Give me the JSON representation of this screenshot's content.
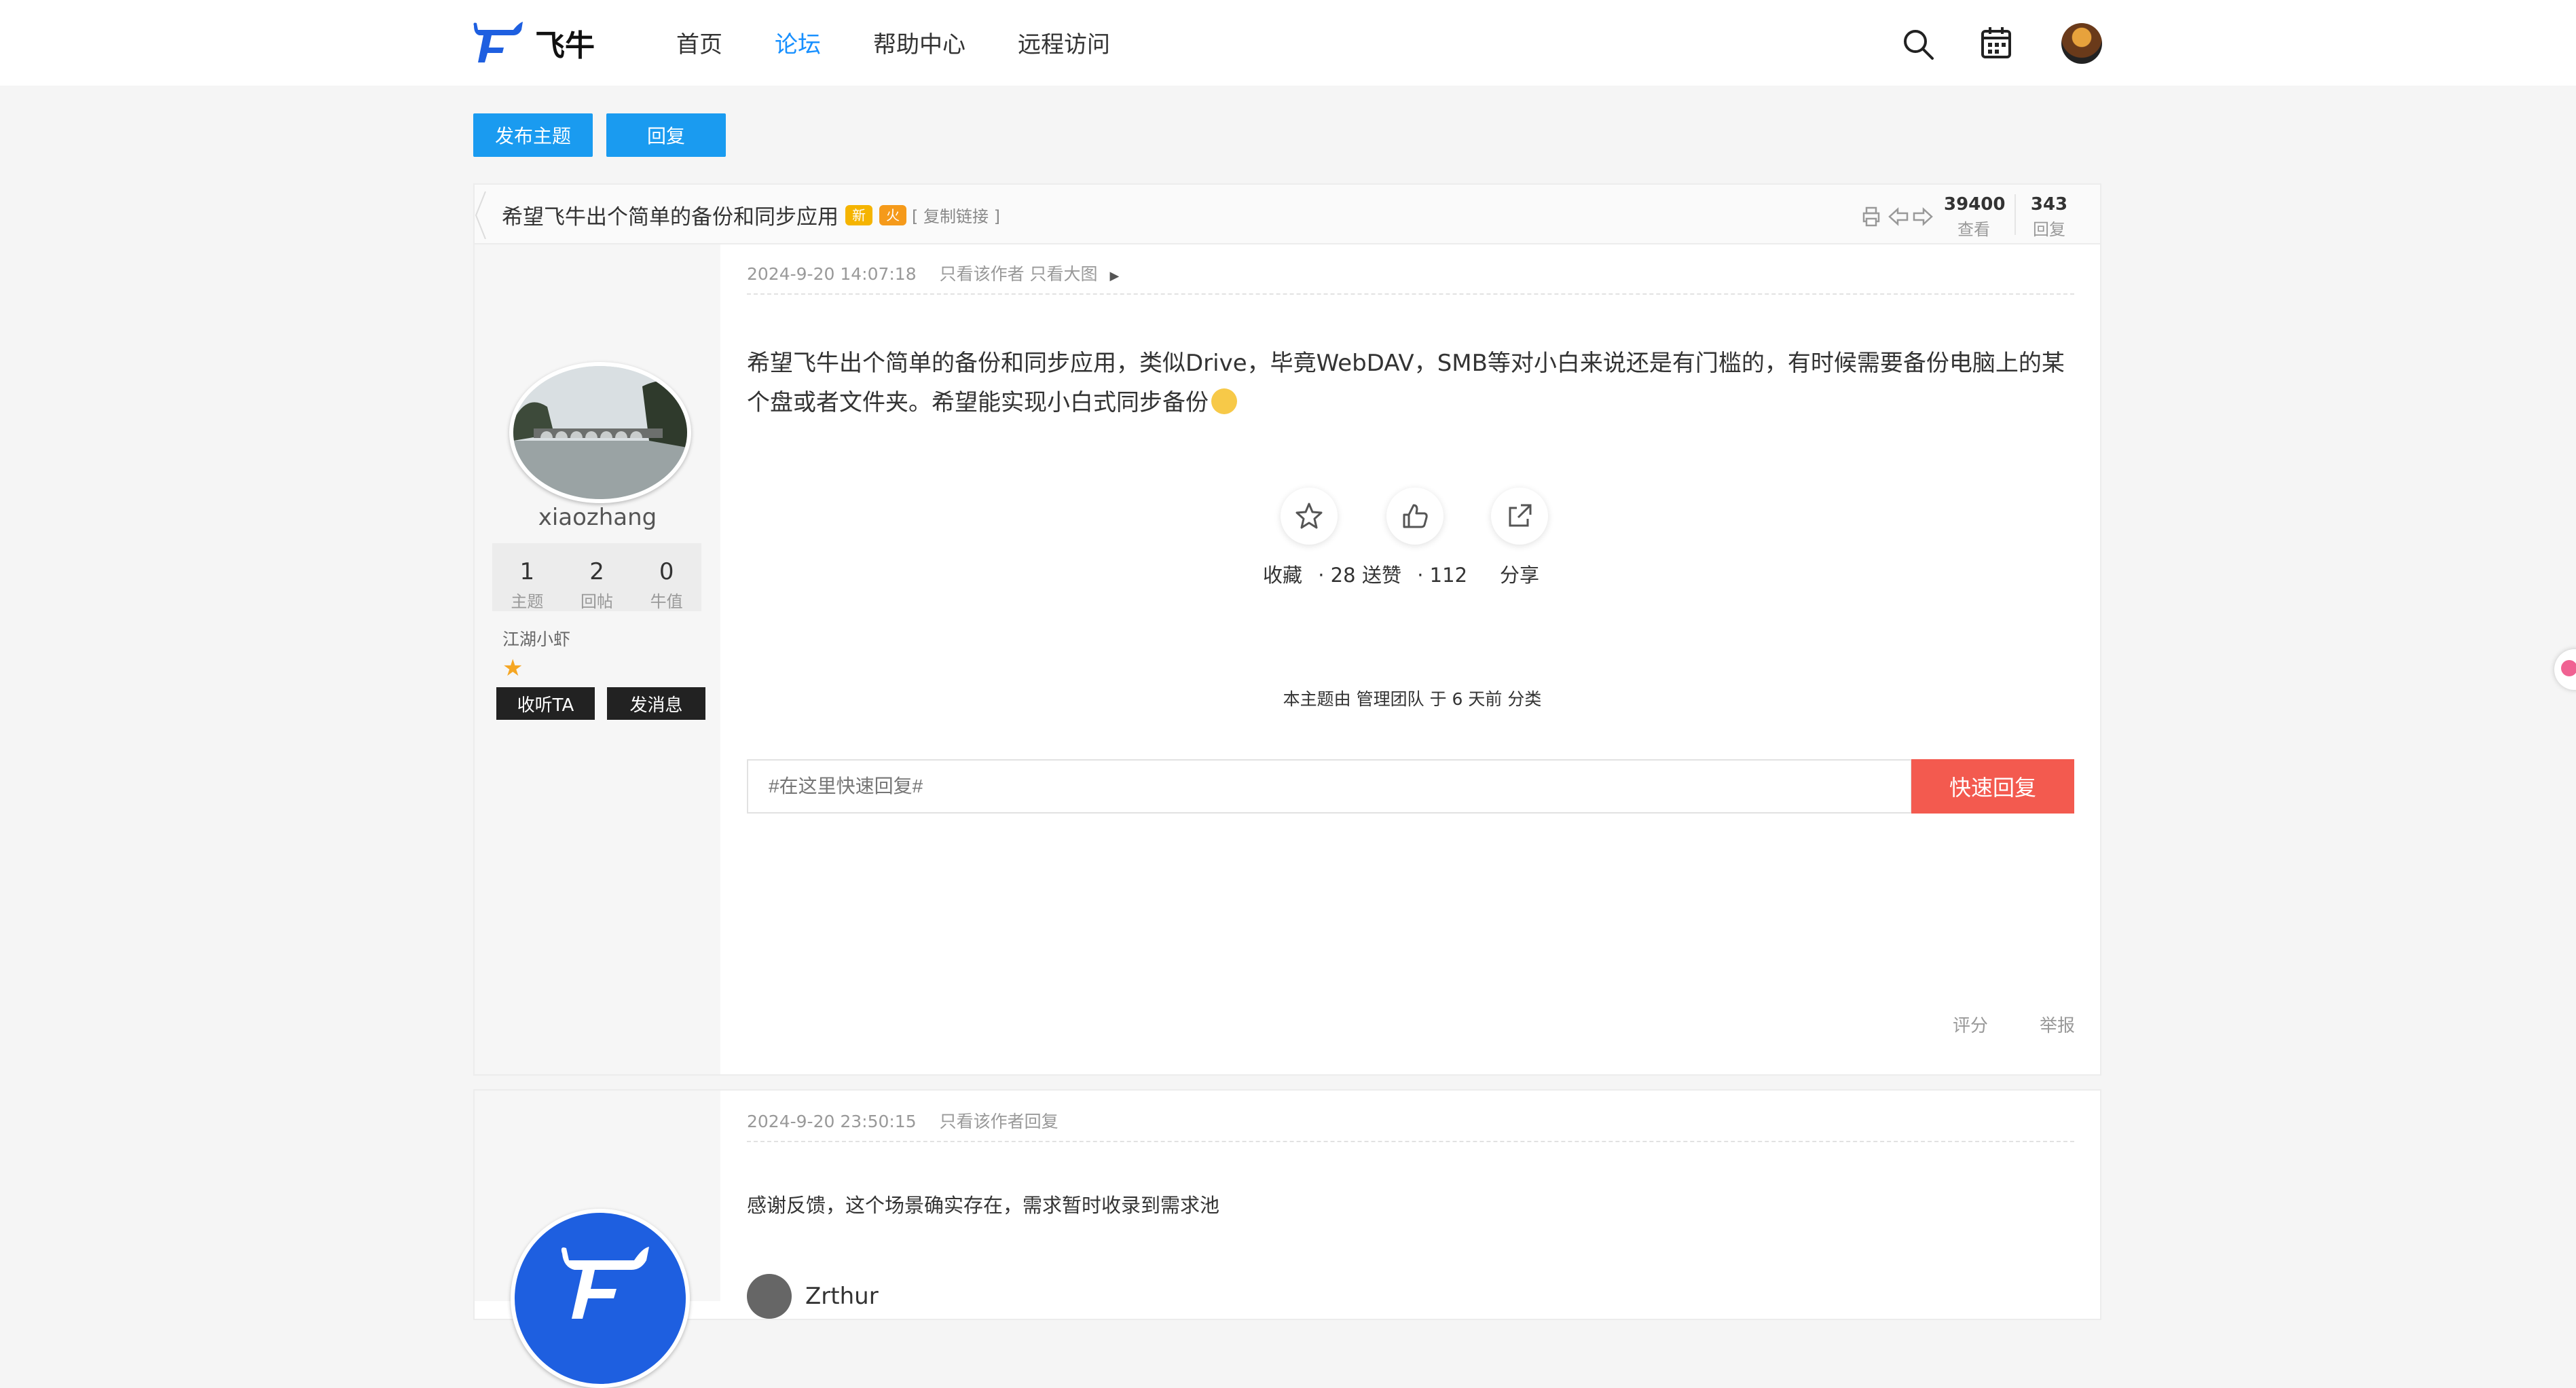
{
  "header": {
    "logo_text": "飞牛",
    "nav": [
      "首页",
      "论坛",
      "帮助中心",
      "远程访问"
    ],
    "active_nav": "论坛"
  },
  "actions": {
    "new_topic": "发布主题",
    "reply": "回复"
  },
  "thread": {
    "title": "希望飞牛出个简单的备份和同步应用",
    "copy_link": "[ 复制链接 ]",
    "views": "39400",
    "views_label": "查看",
    "replies": "343",
    "replies_label": "回复"
  },
  "post1": {
    "author": "xiaozhang",
    "stats": [
      {
        "value": "1",
        "label": "主题"
      },
      {
        "value": "2",
        "label": "回帖"
      },
      {
        "value": "0",
        "label": "牛值"
      }
    ],
    "rank": "江湖小虾",
    "follow_btn": "收听TA",
    "message_btn": "发消息",
    "time": "2024-9-20 14:07:18",
    "meta_links": "只看该作者  只看大图",
    "content": "希望飞牛出个简单的备份和同步应用，类似Drive，毕竟WebDAV，SMB等对小白来说还是有门槛的，有时候需要备份电脑上的某个盘或者文件夹。希望能实现小白式同步备份",
    "fav_label": "收藏",
    "fav_count": "· 28",
    "like_label": "送赞",
    "like_count": "· 112",
    "share_label": "分享",
    "classify_note": "本主题由 管理团队 于 6 天前 分类",
    "quick_reply_placeholder": "#在这里快速回复#",
    "quick_reply_btn": "快速回复",
    "rate": "评分",
    "report": "举报"
  },
  "post2": {
    "time": "2024-9-20 23:50:15",
    "meta_links": "只看该作者回复",
    "content": "感谢反馈，这个场景确实存在，需求暂时收录到需求池",
    "sub_user": "Zrthur"
  },
  "colors": {
    "accent": "#1a9bf0",
    "reply_button": "#f35a4f",
    "nav_active": "#1890ff"
  },
  "icons": [
    "search-icon",
    "calendar-icon",
    "star-icon",
    "thumbs-up-icon",
    "share-icon",
    "print-icon",
    "prev-icon",
    "next-icon"
  ]
}
